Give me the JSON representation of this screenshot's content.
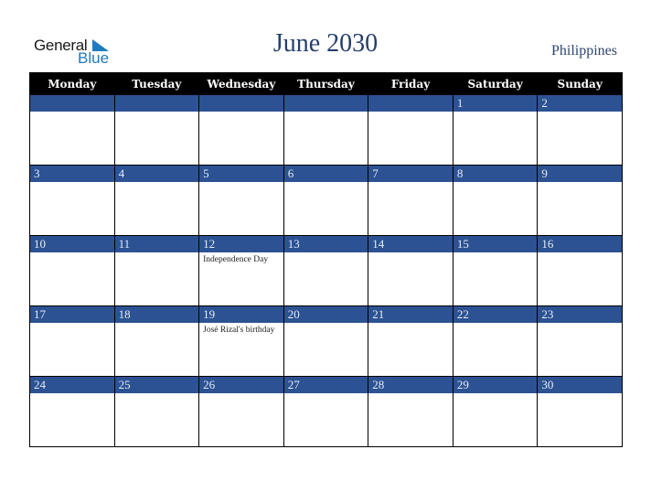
{
  "logo": {
    "general": "General",
    "blue": "Blue"
  },
  "title": "June 2030",
  "country": "Philippines",
  "weekdays": [
    "Monday",
    "Tuesday",
    "Wednesday",
    "Thursday",
    "Friday",
    "Saturday",
    "Sunday"
  ],
  "weeks": [
    [
      "",
      "",
      "",
      "",
      "",
      "1",
      "2"
    ],
    [
      "3",
      "4",
      "5",
      "6",
      "7",
      "8",
      "9"
    ],
    [
      "10",
      "11",
      "12",
      "13",
      "14",
      "15",
      "16"
    ],
    [
      "17",
      "18",
      "19",
      "20",
      "21",
      "22",
      "23"
    ],
    [
      "24",
      "25",
      "26",
      "27",
      "28",
      "29",
      "30"
    ]
  ],
  "events": {
    "12": "Independence Day",
    "19": "José Rizal's birthday"
  },
  "colors": {
    "header_bg": "#000000",
    "date_bar": "#2c5293",
    "title": "#253f6b",
    "logo_blue": "#1f7ac0"
  }
}
